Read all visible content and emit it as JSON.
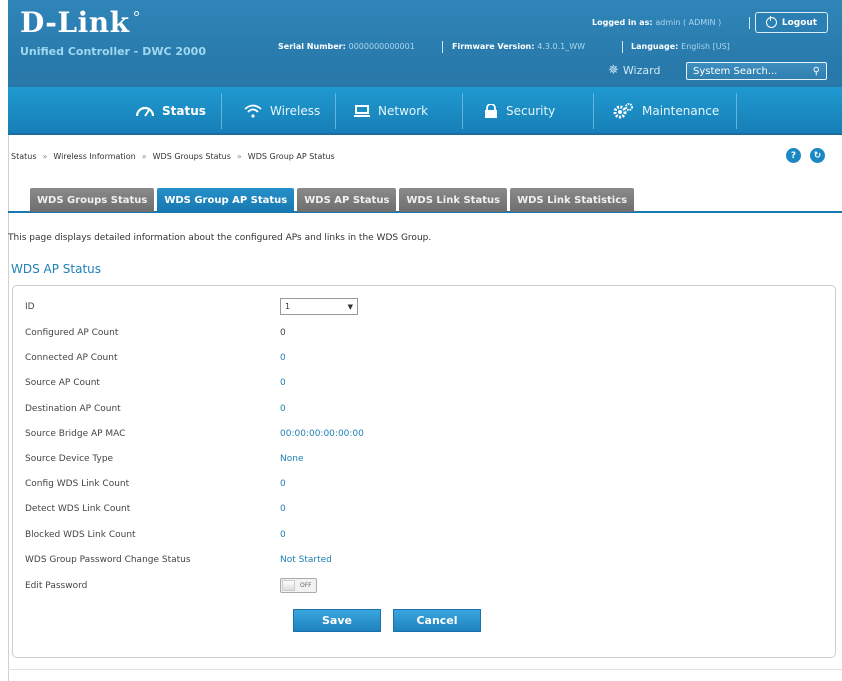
{
  "header": {
    "brand": "D-Link",
    "product": "Unified Controller - DWC 2000",
    "logged_in_label": "Logged in as:",
    "logged_in_value": "admin ( ADMIN )",
    "logout_label": "Logout",
    "serial_label": "Serial Number:",
    "serial_value": "0000000000001",
    "firmware_label": "Firmware Version:",
    "firmware_value": "4.3.0.1_WW",
    "language_label": "Language:",
    "language_value": "English [US]",
    "wizard_label": "Wizard",
    "search_placeholder": "System Search..."
  },
  "menu": [
    {
      "label": "Status",
      "icon": "dashboard-icon"
    },
    {
      "label": "Wireless",
      "icon": "wifi-icon"
    },
    {
      "label": "Network",
      "icon": "network-icon"
    },
    {
      "label": "Security",
      "icon": "lock-icon"
    },
    {
      "label": "Maintenance",
      "icon": "gears-icon"
    }
  ],
  "breadcrumb": [
    "Status",
    "Wireless Information",
    "WDS Groups Status",
    "WDS Group AP Status"
  ],
  "tabs": [
    "WDS Groups Status",
    "WDS Group AP Status",
    "WDS AP Status",
    "WDS Link Status",
    "WDS Link Statistics"
  ],
  "active_tab": "WDS Group AP Status",
  "intro": "This page displays detailed information about the configured APs and links in the WDS Group.",
  "section_title": "WDS AP Status",
  "form": {
    "id_label": "ID",
    "id_value": "1",
    "rows": [
      {
        "label": "Configured AP Count",
        "value": "0"
      },
      {
        "label": "Connected AP Count",
        "value": "0"
      },
      {
        "label": "Source AP Count",
        "value": "0"
      },
      {
        "label": "Destination AP Count",
        "value": "0"
      },
      {
        "label": "Source Bridge AP MAC",
        "value": "00:00:00:00:00:00"
      },
      {
        "label": "Source Device Type",
        "value": "None"
      },
      {
        "label": "Config WDS Link Count",
        "value": "0"
      },
      {
        "label": "Detect WDS Link Count",
        "value": "0"
      },
      {
        "label": "Blocked WDS Link Count",
        "value": "0"
      },
      {
        "label": "WDS Group Password Change Status",
        "value": "Not Started"
      }
    ],
    "edit_password_label": "Edit Password",
    "edit_password_state": "OFF",
    "save_label": "Save",
    "cancel_label": "Cancel"
  },
  "colors": {
    "header_bg": "#2a7cae",
    "menu_bg": "#1a8cc4",
    "accent": "#1e7fb3",
    "tab_inactive": "#7a7a7a"
  }
}
